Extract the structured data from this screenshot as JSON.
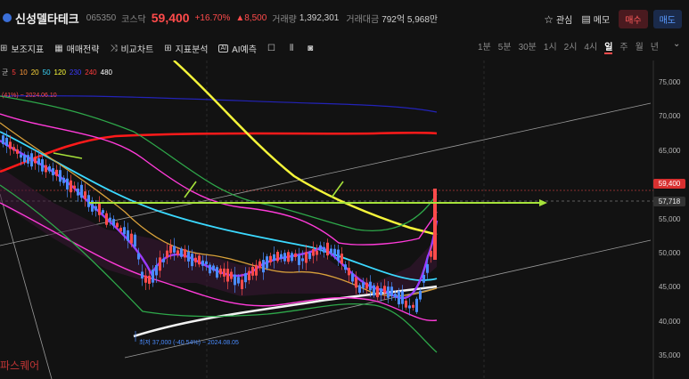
{
  "header": {
    "name": "신성델타테크",
    "code": "065350",
    "market": "코스닥",
    "price": "59,400",
    "change_pct": "+16.70%",
    "change_amt": "▲8,500",
    "volume_label": "거래량",
    "volume": "1,392,301",
    "amount_label": "거래대금",
    "amount": "792억 5,968만",
    "watch_label": "관심",
    "memo_label": "메모",
    "buy_label": "매수",
    "sell_label": "매도"
  },
  "toolbar": {
    "items": [
      "보조지표",
      "매매전략",
      "비교차트",
      "지표분석",
      "AI예측"
    ],
    "icons": [
      "indicator-icon",
      "strategy-icon",
      "compare-icon",
      "analysis-icon",
      "ai-icon",
      "square-icon",
      "candle-icon",
      "camera-icon"
    ]
  },
  "periods": {
    "items": [
      "1분",
      "5분",
      "30분",
      "1시",
      "2시",
      "4시",
      "일",
      "주",
      "월",
      "년"
    ],
    "active": "일"
  },
  "ma_legend": {
    "prefix": "균",
    "items": [
      {
        "label": "5",
        "color": "#ff3b3b"
      },
      {
        "label": "10",
        "color": "#ff9a3b"
      },
      {
        "label": "20",
        "color": "#ffd93b"
      },
      {
        "label": "50",
        "color": "#3bd9ff"
      },
      {
        "label": "120",
        "color": "#ffff3b"
      },
      {
        "label": "230",
        "color": "#3b3bff"
      },
      {
        "label": "240",
        "color": "#ff3b3b"
      },
      {
        "label": "480",
        "color": "#ffffff"
      }
    ]
  },
  "notes": {
    "high": "(41%) ~ 2024.06.10",
    "low": "최저 37,000 (-40.54%) ~ 2024.08.05"
  },
  "price_axis": {
    "ticks": [
      "75,000",
      "70,000",
      "65,000",
      "60,000",
      "55,000",
      "50,000",
      "45,000",
      "40,000",
      "35,000"
    ],
    "current_tag": "59,400",
    "line_tag": "57,718"
  },
  "watermark": "파스퀘어",
  "colors": {
    "up": "#ff4b4b",
    "down": "#4a8cff",
    "bg": "#121212"
  }
}
